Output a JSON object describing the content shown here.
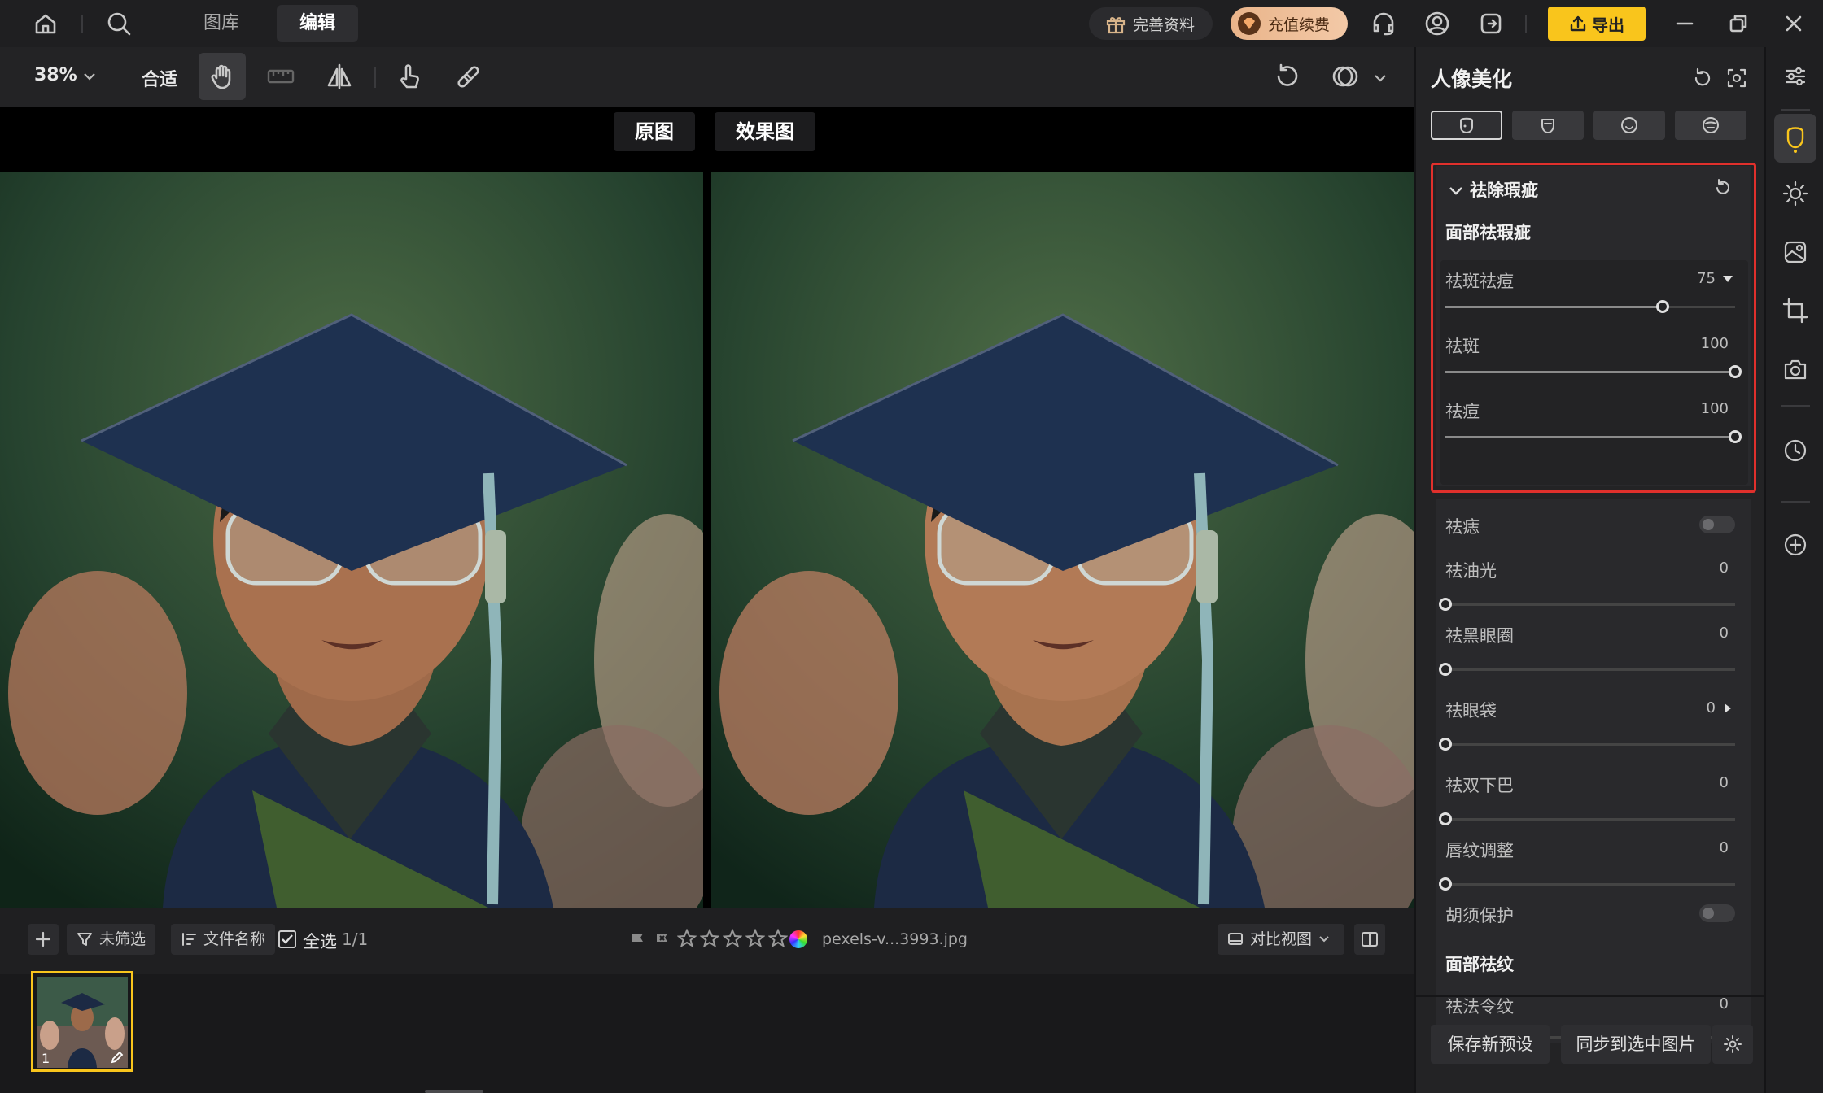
{
  "topbar": {
    "tabs": [
      {
        "label": "图库"
      },
      {
        "label": "编辑"
      }
    ],
    "profile_label": "完善资料",
    "recharge_label": "充值续费",
    "export_label": "导出"
  },
  "toolbar": {
    "zoom": "38%",
    "fit_label": "合适"
  },
  "compare": {
    "original_label": "原图",
    "effect_label": "效果图"
  },
  "filmbar": {
    "unfiltered_label": "未筛选",
    "filename_sort_label": "文件名称",
    "select_all_label": "全选",
    "count": "1/1",
    "filename": "pexels-v...3993.jpg",
    "view_mode_label": "对比视图"
  },
  "filmstrip": {
    "thumb_index": "1"
  },
  "panel": {
    "title": "人像美化",
    "section_blemish": "祛除瑕疵",
    "subsection_face": "面部祛瑕疵",
    "sliders_highlight": [
      {
        "label": "祛斑祛痘",
        "value": "75",
        "fraction": 0.75
      },
      {
        "label": "祛斑",
        "value": "100",
        "fraction": 1.0
      },
      {
        "label": "祛痘",
        "value": "100",
        "fraction": 1.0
      }
    ],
    "mole_label": "祛痣",
    "sliders_more": [
      {
        "label": "祛油光",
        "value": "0",
        "fraction": 0
      },
      {
        "label": "祛黑眼圈",
        "value": "0",
        "fraction": 0
      },
      {
        "label": "祛眼袋",
        "value": "0",
        "fraction": 0
      },
      {
        "label": "祛双下巴",
        "value": "0",
        "fraction": 0
      },
      {
        "label": "唇纹调整",
        "value": "0",
        "fraction": 0
      }
    ],
    "beard_label": "胡须保护",
    "subsection_wrinkle": "面部祛纹",
    "nasolabial": {
      "label": "祛法令纹",
      "value": "0",
      "fraction": 0
    },
    "save_preset_label": "保存新预设",
    "sync_label": "同步到选中图片"
  },
  "colors": {
    "accent_yellow": "#f9c51c",
    "highlight_red": "#e0302c"
  }
}
